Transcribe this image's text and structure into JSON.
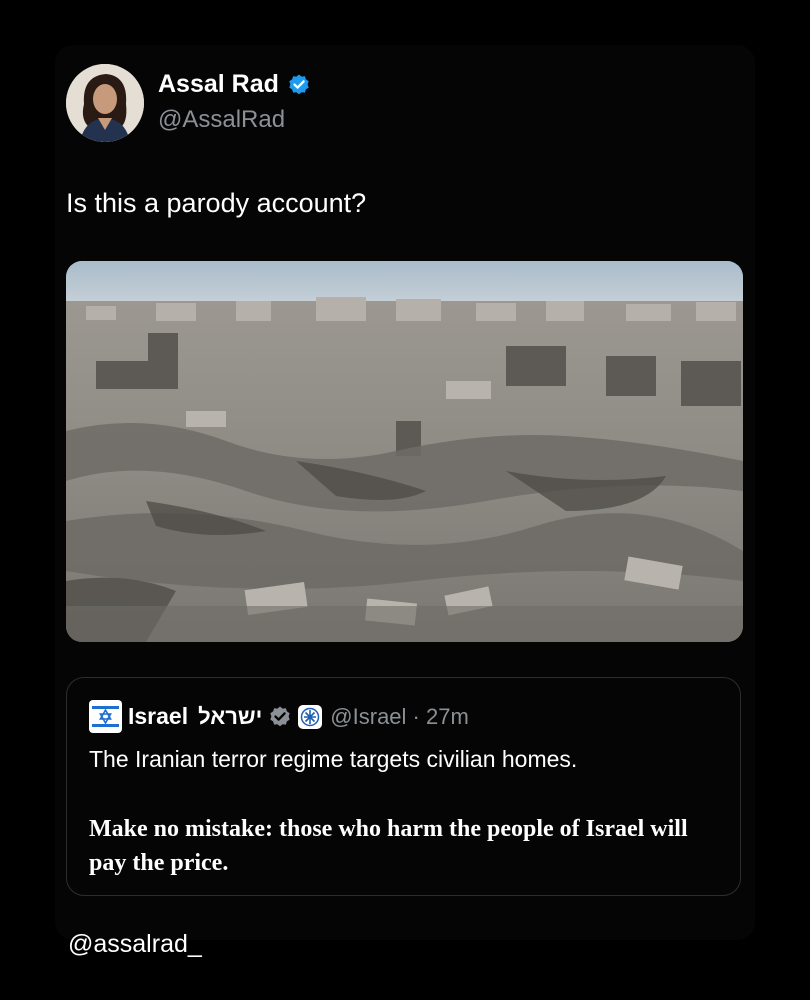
{
  "tweet": {
    "author_name": "Assal Rad",
    "author_handle": "@AssalRad",
    "text": "Is this a parody account?",
    "verified_icon": "verified-badge-icon",
    "accent_color": "#1d9bf0"
  },
  "quoted": {
    "author_name": "Israel",
    "author_name_hebrew": "ישראל",
    "handle_time": "@Israel · 27m",
    "line1": "The Iranian terror regime targets civilian homes.",
    "line2": "Make no mistake: those who harm the people of Israel will pay the price.",
    "avatar_icon": "star-of-david-icon",
    "government_badge_icon": "israel-emblem-icon",
    "verified_icon": "grey-verified-badge-icon"
  },
  "watermark": "@assalrad_",
  "colors": {
    "background": "#000000",
    "text": "#ffffff",
    "secondary_text": "#8b9096",
    "border": "#2b2e31"
  }
}
